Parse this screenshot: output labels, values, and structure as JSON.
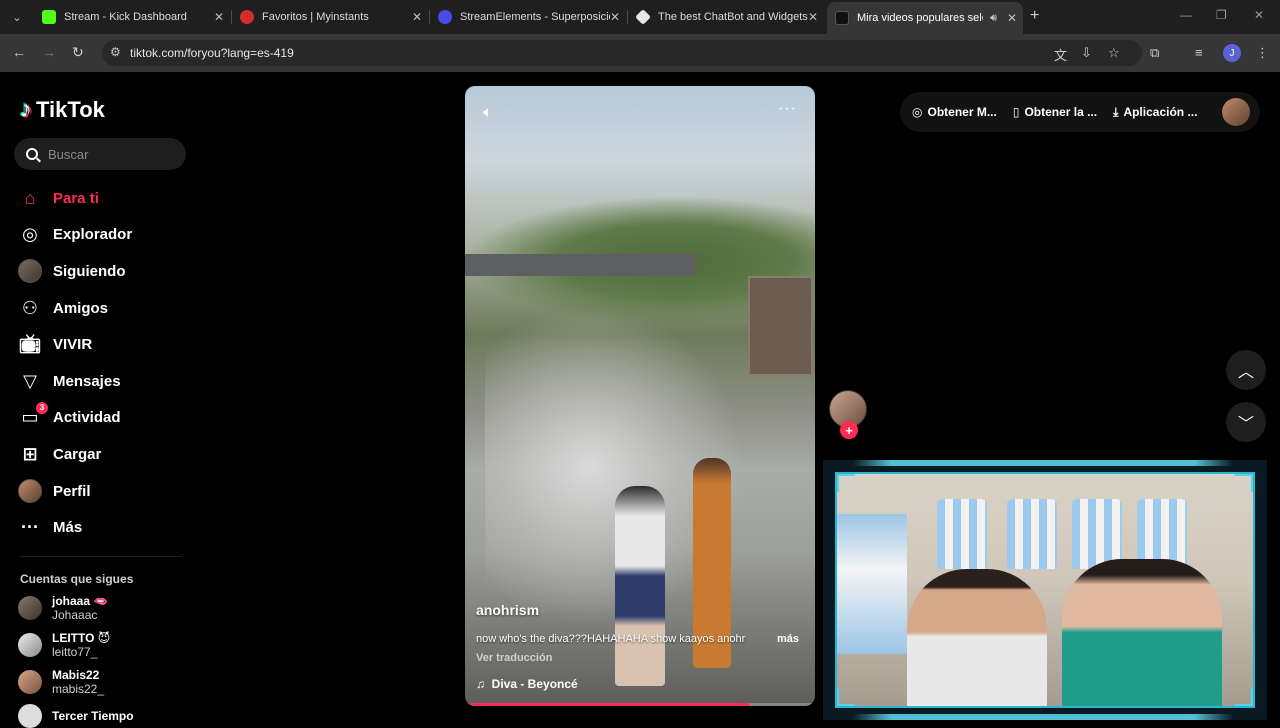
{
  "browser": {
    "tabs": [
      {
        "title": "Stream - Kick Dashboard",
        "favicon_color": "#53fc18"
      },
      {
        "title": "Favoritos | Myinstants",
        "favicon_color": "#d62b2b"
      },
      {
        "title": "StreamElements - Superposicio",
        "favicon_color": "#4a4ae8"
      },
      {
        "title": "The best ChatBot and Widgets",
        "favicon_color": "#e6e6e6"
      },
      {
        "title": "Mira videos populares selec",
        "favicon_color": "#111111",
        "active": true
      }
    ],
    "url": "tiktok.com/foryou?lang=es-419",
    "profile_initial": "J"
  },
  "tiktok": {
    "brand": "TikTok",
    "search_placeholder": "Buscar",
    "nav": [
      {
        "label": "Para ti",
        "icon": "home-icon",
        "active": true
      },
      {
        "label": "Explorador",
        "icon": "compass-icon"
      },
      {
        "label": "Siguiendo",
        "icon": "avatar-icon"
      },
      {
        "label": "Amigos",
        "icon": "friends-icon"
      },
      {
        "label": "VIVIR",
        "icon": "live-icon"
      },
      {
        "label": "Mensajes",
        "icon": "send-icon"
      },
      {
        "label": "Actividad",
        "icon": "inbox-icon",
        "badge": "3"
      },
      {
        "label": "Cargar",
        "icon": "plus-square-icon"
      },
      {
        "label": "Perfil",
        "icon": "avatar-icon"
      },
      {
        "label": "Más",
        "icon": "more-icon"
      }
    ],
    "following_header": "Cuentas que sigues",
    "following": [
      {
        "name": "johaaa",
        "emoji": "🫦",
        "handle": "Johaaac"
      },
      {
        "name": "LEITTO",
        "emoji": "😈",
        "handle": "leitto77_"
      },
      {
        "name": "Mabis22",
        "emoji": "",
        "handle": "mabis22_"
      },
      {
        "name": "Tercer Tiempo",
        "emoji": "",
        "handle": ""
      }
    ],
    "top_actions": [
      {
        "label": "Obtener M...",
        "icon": "coin-icon"
      },
      {
        "label": "Obtener la ...",
        "icon": "phone-icon"
      },
      {
        "label": "Aplicación ...",
        "icon": "download-icon"
      }
    ],
    "video": {
      "author": "anohrism",
      "caption": "now who's the diva???HAHAHAHA show kaayos anohr",
      "more": "más",
      "translate": "Ver traducción",
      "music": "Diva - Beyoncé",
      "progress": 0.81
    }
  }
}
